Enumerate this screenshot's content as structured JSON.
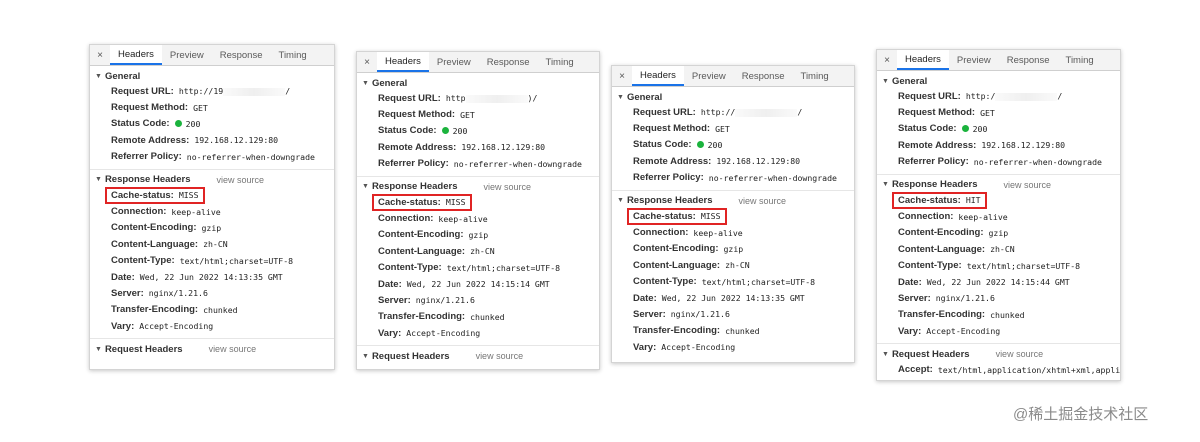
{
  "tabs": {
    "close": "×",
    "headers": "Headers",
    "preview": "Preview",
    "response": "Response",
    "timing": "Timing"
  },
  "labels": {
    "general": "General",
    "response_headers": "Response Headers",
    "request_headers": "Request Headers",
    "view_source": "view source",
    "request_url": "Request URL:",
    "request_method": "Request Method:",
    "status_code": "Status Code:",
    "remote_address": "Remote Address:",
    "referrer_policy": "Referrer Policy:",
    "cache_status": "Cache-status:",
    "connection": "Connection:",
    "content_encoding": "Content-Encoding:",
    "content_language": "Content-Language:",
    "content_type": "Content-Type:",
    "date": "Date:",
    "server": "Server:",
    "transfer_encoding": "Transfer-Encoding:",
    "vary": "Vary:",
    "accept": "Accept:"
  },
  "panels": [
    {
      "request_url_prefix": "http://19",
      "request_url_suffix": "/",
      "method": "GET",
      "status": "200",
      "remote": "192.168.12.129:80",
      "referrer": "no-referrer-when-downgrade",
      "cache_status": "MISS",
      "connection": "keep-alive",
      "content_encoding": "gzip",
      "content_language": "zh-CN",
      "content_type": "text/html;charset=UTF-8",
      "date": "Wed, 22 Jun 2022 14:13:35 GMT",
      "server": "nginx/1.21.6",
      "transfer_encoding": "chunked",
      "vary": "Accept-Encoding"
    },
    {
      "request_url_prefix": "http",
      "request_url_suffix": ")/",
      "method": "GET",
      "status": "200",
      "remote": "192.168.12.129:80",
      "referrer": "no-referrer-when-downgrade",
      "cache_status": "MISS",
      "connection": "keep-alive",
      "content_encoding": "gzip",
      "content_language": "zh-CN",
      "content_type": "text/html;charset=UTF-8",
      "date": "Wed, 22 Jun 2022 14:15:14 GMT",
      "server": "nginx/1.21.6",
      "transfer_encoding": "chunked",
      "vary": "Accept-Encoding"
    },
    {
      "request_url_prefix": "http://",
      "request_url_suffix": "/",
      "method": "GET",
      "status": "200",
      "remote": "192.168.12.129:80",
      "referrer": "no-referrer-when-downgrade",
      "cache_status": "MISS",
      "connection": "keep-alive",
      "content_encoding": "gzip",
      "content_language": "zh-CN",
      "content_type": "text/html;charset=UTF-8",
      "date": "Wed, 22 Jun 2022 14:13:35 GMT",
      "server": "nginx/1.21.6",
      "transfer_encoding": "chunked",
      "vary": "Accept-Encoding"
    },
    {
      "request_url_prefix": "http:/",
      "request_url_suffix": "/",
      "method": "GET",
      "status": "200",
      "remote": "192.168.12.129:80",
      "referrer": "no-referrer-when-downgrade",
      "cache_status": "HIT",
      "connection": "keep-alive",
      "content_encoding": "gzip",
      "content_language": "zh-CN",
      "content_type": "text/html;charset=UTF-8",
      "date": "Wed, 22 Jun 2022 14:15:44 GMT",
      "server": "nginx/1.21.6",
      "transfer_encoding": "chunked",
      "vary": "Accept-Encoding",
      "accept": "text/html,application/xhtml+xml,applic"
    }
  ],
  "watermark": "@稀土掘金技术社区",
  "colors": {
    "highlight": "#e02424",
    "status_ok": "#1bb33d",
    "active_tab": "#1a73e8"
  }
}
